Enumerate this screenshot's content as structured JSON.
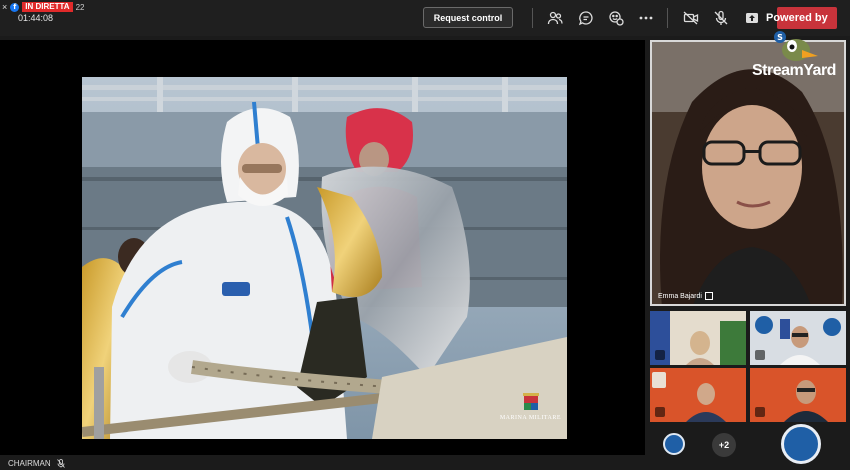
{
  "header": {
    "close_glyph": "×",
    "live_label": "IN DIRETTA",
    "live_extra": "22",
    "timer": "01:44:08",
    "request_control_label": "Request control",
    "powered_label": "Powered by",
    "icons": [
      "people-icon",
      "chat-icon",
      "reactions-icon",
      "more-icon",
      "camera-off-icon",
      "mic-off-icon",
      "share-icon"
    ]
  },
  "branding": {
    "streamyard_text": "StreamYard",
    "watermark": "MARINA MILITARE"
  },
  "speaker": {
    "name": "Emma Bajardi"
  },
  "participants": {
    "overflow_count": "+2"
  },
  "footer": {
    "chairman_label": "CHAIRMAN"
  },
  "colors": {
    "live_red": "#e02a2a",
    "brand_red": "#c8333b",
    "tile_border": "#d8d8d8"
  }
}
